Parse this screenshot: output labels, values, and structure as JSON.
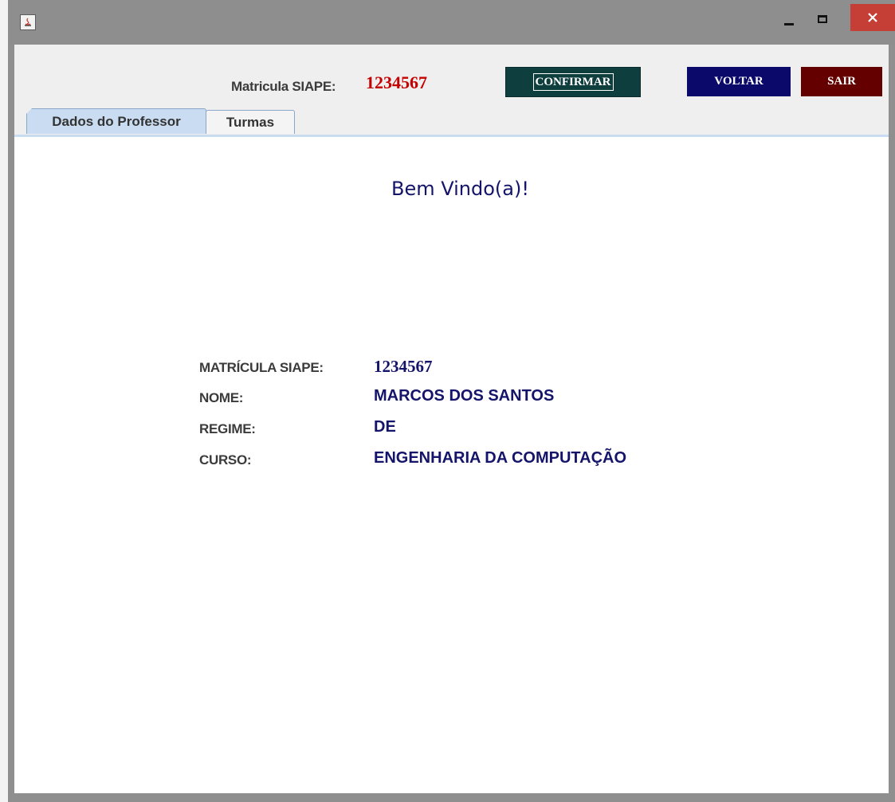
{
  "header": {
    "siape_label": "Matricula SIAPE:",
    "siape_value": "1234567",
    "confirm_label": "CONFIRMAR",
    "back_label": "VOLTAR",
    "exit_label": "SAIR"
  },
  "tabs": [
    {
      "label": "Dados do Professor",
      "selected": true
    },
    {
      "label": "Turmas",
      "selected": false
    }
  ],
  "welcome": "Bem Vindo(a)!",
  "fields": [
    {
      "label": "MATRÍCULA SIAPE:",
      "value": "1234567"
    },
    {
      "label": "NOME:",
      "value": "MARCOS DOS SANTOS"
    },
    {
      "label": "REGIME:",
      "value": "DE"
    },
    {
      "label": "CURSO:",
      "value": "ENGENHARIA DA COMPUTAÇÃO"
    }
  ],
  "window_controls": {
    "minimize_icon": "minimize-icon",
    "maximize_icon": "maximize-icon",
    "close_icon": "close-icon"
  },
  "colors": {
    "siape_value": "#c40000",
    "confirm_bg": "#0f3e3e",
    "back_bg": "#0b0a6a",
    "exit_bg": "#640000",
    "text_blue": "#14146a",
    "close_bg": "#c63f37"
  }
}
